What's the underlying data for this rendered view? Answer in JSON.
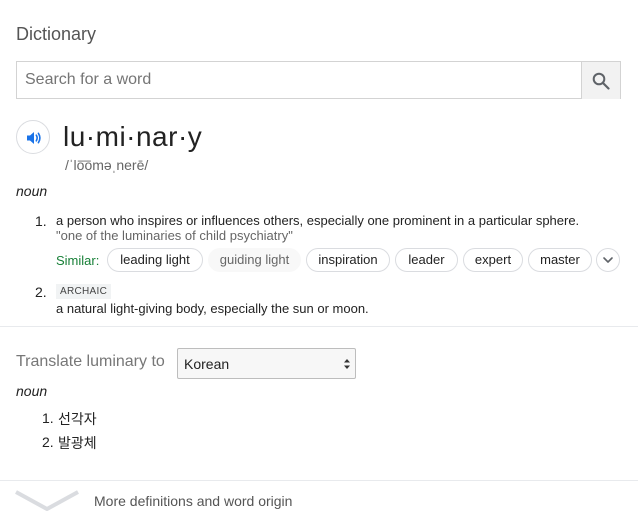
{
  "header": {
    "title": "Dictionary"
  },
  "search": {
    "placeholder": "Search for a word",
    "icon": "search-icon"
  },
  "entry": {
    "word": "lu·mi·nar·y",
    "phonetic": "/ˈlo͞oməˌnerē/",
    "part_of_speech": "noun",
    "definitions": [
      {
        "number": "1.",
        "text": "a person who inspires or influences others, especially one prominent in a particular sphere.",
        "example": "\"one of the luminaries of child psychiatry\"",
        "similar_label": "Similar:",
        "similar": [
          "leading light",
          "guiding light",
          "inspiration",
          "leader",
          "expert",
          "master"
        ]
      },
      {
        "number": "2.",
        "tag": "ARCHAIC",
        "text": "a natural light-giving body, especially the sun or moon."
      }
    ]
  },
  "translate": {
    "label": "Translate luminary to",
    "selected_language": "Korean",
    "part_of_speech": "noun",
    "items": [
      {
        "number": "1.",
        "text": "선각자"
      },
      {
        "number": "2.",
        "text": "발광체"
      }
    ]
  },
  "footer": {
    "more_label": "More definitions and word origin"
  }
}
